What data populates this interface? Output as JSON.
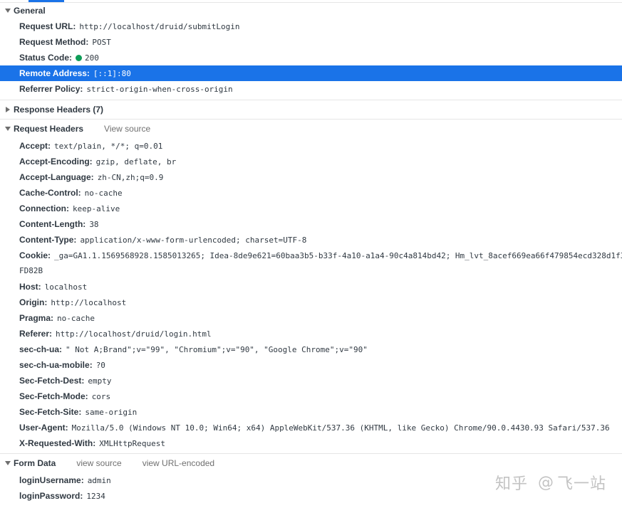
{
  "general": {
    "title": "General",
    "rows": [
      {
        "key": "Request URL:",
        "value": "http://localhost/druid/submitLogin"
      },
      {
        "key": "Request Method:",
        "value": "POST"
      },
      {
        "key": "Status Code:",
        "value": "200"
      },
      {
        "key": "Remote Address:",
        "value": "[::1]:80"
      },
      {
        "key": "Referrer Policy:",
        "value": "strict-origin-when-cross-origin"
      }
    ]
  },
  "response_headers": {
    "title": "Response Headers (7)"
  },
  "request_headers": {
    "title": "Request Headers",
    "view_source": "View source",
    "rows": [
      {
        "key": "Accept:",
        "value": "text/plain, */*; q=0.01"
      },
      {
        "key": "Accept-Encoding:",
        "value": "gzip, deflate, br"
      },
      {
        "key": "Accept-Language:",
        "value": "zh-CN,zh;q=0.9"
      },
      {
        "key": "Cache-Control:",
        "value": "no-cache"
      },
      {
        "key": "Connection:",
        "value": "keep-alive"
      },
      {
        "key": "Content-Length:",
        "value": "38"
      },
      {
        "key": "Content-Type:",
        "value": "application/x-www-form-urlencoded; charset=UTF-8"
      },
      {
        "key": "Cookie:",
        "value": "_ga=GA1.1.1569568928.1585013265; Idea-8de9e621=60baa3b5-b33f-4a10-a1a4-90c4a814bd42; Hm_lvt_8acef669ea66f479854ecd328d1f3",
        "continuation": "FD82B"
      },
      {
        "key": "Host:",
        "value": "localhost"
      },
      {
        "key": "Origin:",
        "value": "http://localhost"
      },
      {
        "key": "Pragma:",
        "value": "no-cache"
      },
      {
        "key": "Referer:",
        "value": "http://localhost/druid/login.html"
      },
      {
        "key": "sec-ch-ua:",
        "value": "\" Not A;Brand\";v=\"99\", \"Chromium\";v=\"90\", \"Google Chrome\";v=\"90\""
      },
      {
        "key": "sec-ch-ua-mobile:",
        "value": "?0"
      },
      {
        "key": "Sec-Fetch-Dest:",
        "value": "empty"
      },
      {
        "key": "Sec-Fetch-Mode:",
        "value": "cors"
      },
      {
        "key": "Sec-Fetch-Site:",
        "value": "same-origin"
      },
      {
        "key": "User-Agent:",
        "value": "Mozilla/5.0 (Windows NT 10.0; Win64; x64) AppleWebKit/537.36 (KHTML, like Gecko) Chrome/90.0.4430.93 Safari/537.36"
      },
      {
        "key": "X-Requested-With:",
        "value": "XMLHttpRequest"
      }
    ]
  },
  "form_data": {
    "title": "Form Data",
    "view_source": "view source",
    "view_url_encoded": "view URL-encoded",
    "rows": [
      {
        "key": "loginUsername:",
        "value": "admin"
      },
      {
        "key": "loginPassword:",
        "value": "1234"
      }
    ]
  },
  "watermark": {
    "brand": "知乎",
    "at": "@",
    "author": "飞一站"
  },
  "colors": {
    "selected_row": "#1a73e8",
    "status_ok": "#0f9d58",
    "link_gray": "#707070"
  }
}
